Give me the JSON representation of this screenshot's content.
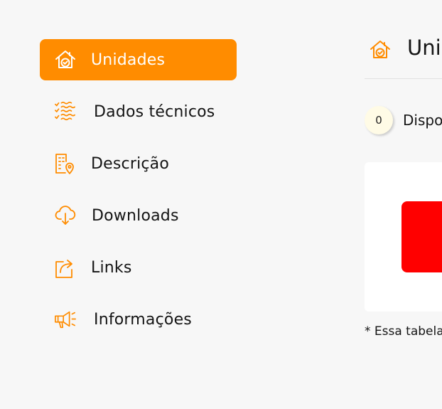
{
  "sidebar": {
    "items": [
      {
        "label": "Unidades",
        "icon": "house-check-icon",
        "active": true
      },
      {
        "label": "Dados técnicos",
        "icon": "checklist-icon",
        "active": false
      },
      {
        "label": "Descrição",
        "icon": "building-location-icon",
        "active": false
      },
      {
        "label": "Downloads",
        "icon": "cloud-download-icon",
        "active": false
      },
      {
        "label": "Links",
        "icon": "share-icon",
        "active": false
      },
      {
        "label": "Informações",
        "icon": "megaphone-icon",
        "active": false
      }
    ]
  },
  "main": {
    "title": "Unic",
    "icon": "house-check-icon",
    "count": "0",
    "count_label": "Dispo",
    "footnote": "* Essa tabela"
  },
  "colors": {
    "accent": "#ff8c00",
    "red_block": "#ff0000",
    "background": "#f7f7f7"
  }
}
